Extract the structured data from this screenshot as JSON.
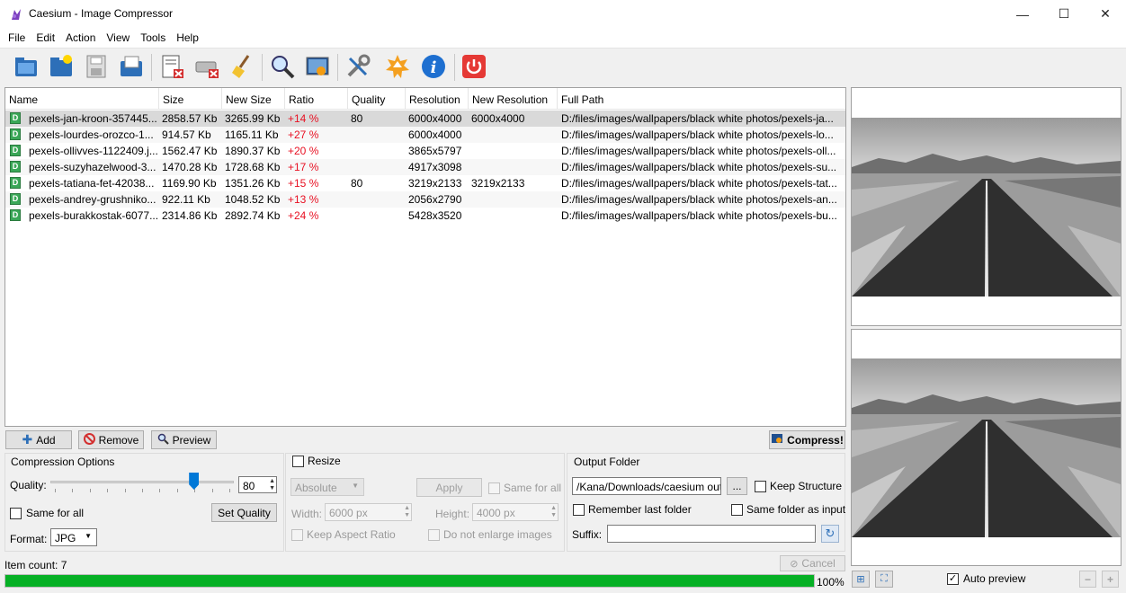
{
  "window": {
    "title": "Caesium - Image Compressor",
    "minimize": "—",
    "maximize": "☐",
    "close": "✕"
  },
  "menu": [
    "File",
    "Edit",
    "Action",
    "View",
    "Tools",
    "Help"
  ],
  "toolbar": [
    "open-files-icon",
    "open-folder-icon",
    "save-list-icon",
    "open-list-icon",
    "remove-item-icon",
    "clear-list-icon",
    "clean-icon",
    "preview-icon",
    "compare-icon",
    "settings-icon",
    "update-icon",
    "info-icon",
    "exit-icon"
  ],
  "table": {
    "columns": [
      "Name",
      "Size",
      "New Size",
      "Ratio",
      "Quality",
      "Resolution",
      "New Resolution",
      "Full Path"
    ],
    "rows": [
      {
        "name": "pexels-jan-kroon-357445...",
        "size": "2858.57 Kb",
        "new_size": "3265.99 Kb",
        "ratio": "+14 %",
        "quality": "80",
        "resolution": "6000x4000",
        "new_resolution": "6000x4000",
        "path": "D:/files/images/wallpapers/black white photos/pexels-ja..."
      },
      {
        "name": "pexels-lourdes-orozco-1...",
        "size": "914.57 Kb",
        "new_size": "1165.11 Kb",
        "ratio": "+27 %",
        "quality": "",
        "resolution": "6000x4000",
        "new_resolution": "",
        "path": "D:/files/images/wallpapers/black white photos/pexels-lo..."
      },
      {
        "name": "pexels-ollivves-1122409.j...",
        "size": "1562.47 Kb",
        "new_size": "1890.37 Kb",
        "ratio": "+20 %",
        "quality": "",
        "resolution": "3865x5797",
        "new_resolution": "",
        "path": "D:/files/images/wallpapers/black white photos/pexels-oll..."
      },
      {
        "name": "pexels-suzyhazelwood-3...",
        "size": "1470.28 Kb",
        "new_size": "1728.68 Kb",
        "ratio": "+17 %",
        "quality": "",
        "resolution": "4917x3098",
        "new_resolution": "",
        "path": "D:/files/images/wallpapers/black white photos/pexels-su..."
      },
      {
        "name": "pexels-tatiana-fet-42038...",
        "size": "1169.90 Kb",
        "new_size": "1351.26 Kb",
        "ratio": "+15 %",
        "quality": "80",
        "resolution": "3219x2133",
        "new_resolution": "3219x2133",
        "path": "D:/files/images/wallpapers/black white photos/pexels-tat..."
      },
      {
        "name": "pexels-andrey-grushniko...",
        "size": "922.11 Kb",
        "new_size": "1048.52 Kb",
        "ratio": "+13 %",
        "quality": "",
        "resolution": "2056x2790",
        "new_resolution": "",
        "path": "D:/files/images/wallpapers/black white photos/pexels-an..."
      },
      {
        "name": "pexels-burakkostak-6077...",
        "size": "2314.86 Kb",
        "new_size": "2892.74 Kb",
        "ratio": "+24 %",
        "quality": "",
        "resolution": "5428x3520",
        "new_resolution": "",
        "path": "D:/files/images/wallpapers/black white photos/pexels-bu..."
      }
    ],
    "file_icon_letter": "D"
  },
  "list_buttons": {
    "add": "Add",
    "remove": "Remove",
    "preview": "Preview",
    "compress": "Compress!"
  },
  "compression": {
    "title": "Compression Options",
    "quality_label": "Quality:",
    "quality_value": "80",
    "quality_fraction": 0.8,
    "same_for_all": "Same for all",
    "set_quality": "Set Quality",
    "format_label": "Format:",
    "format_value": "JPG"
  },
  "resize": {
    "title": "Resize",
    "mode": "Absolute",
    "apply": "Apply",
    "same_for_all": "Same for all",
    "width_label": "Width:",
    "width_value": "6000 px",
    "height_label": "Height:",
    "height_value": "4000 px",
    "keep_aspect": "Keep Aspect Ratio",
    "no_enlarge": "Do not enlarge images"
  },
  "output": {
    "title": "Output Folder",
    "path": "/Kana/Downloads/caesium output",
    "browse": "...",
    "keep_structure": "Keep Structure",
    "remember_last": "Remember last folder",
    "same_folder": "Same folder as input",
    "suffix_label": "Suffix:",
    "suffix_value": ""
  },
  "status": {
    "item_count": "Item count: 7",
    "cancel": "Cancel",
    "progress_text": "100%",
    "progress_fraction": 1.0
  },
  "preview_controls": {
    "auto_preview": "Auto preview",
    "auto_preview_checked": true,
    "zoom_out": "−",
    "zoom_in": "+"
  },
  "colors": {
    "ratio_increase": "#e81123",
    "progress": "#06b025",
    "slider_handle": "#0078d7"
  }
}
